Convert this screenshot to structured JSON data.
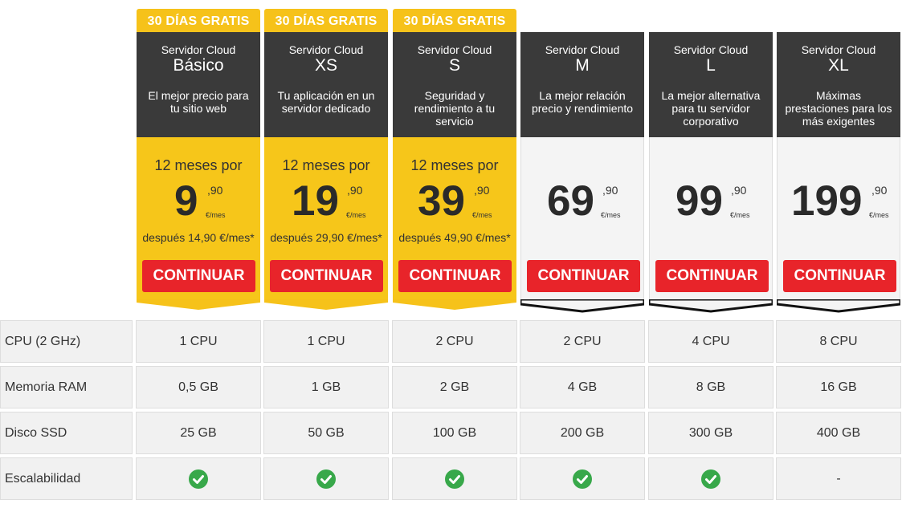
{
  "plans": [
    {
      "badge": "30 DÍAS GRATIS",
      "kind": "Servidor Cloud",
      "name": "Básico",
      "desc": "El mejor precio para tu sitio web",
      "pre": "12 meses por",
      "price_int": "9",
      "price_dec": ",90",
      "unit": "€/mes",
      "after": "después 14,90 €/mes*",
      "cta": "CONTINUAR",
      "cpu": "1 CPU",
      "ram": "0,5 GB",
      "ssd": "25 GB",
      "scal": true
    },
    {
      "badge": "30 DÍAS GRATIS",
      "kind": "Servidor Cloud",
      "name": "XS",
      "desc": "Tu aplicación en un servidor dedicado",
      "pre": "12 meses por",
      "price_int": "19",
      "price_dec": ",90",
      "unit": "€/mes",
      "after": "después 29,90 €/mes*",
      "cta": "CONTINUAR",
      "cpu": "1 CPU",
      "ram": "1 GB",
      "ssd": "50 GB",
      "scal": true
    },
    {
      "badge": "30 DÍAS GRATIS",
      "kind": "Servidor Cloud",
      "name": "S",
      "desc": "Seguridad y rendimiento a tu servicio",
      "pre": "12 meses por",
      "price_int": "39",
      "price_dec": ",90",
      "unit": "€/mes",
      "after": "después 49,90 €/mes*",
      "cta": "CONTINUAR",
      "cpu": "2 CPU",
      "ram": "2 GB",
      "ssd": "100 GB",
      "scal": true
    },
    {
      "badge": "",
      "kind": "Servidor Cloud",
      "name": "M",
      "desc": "La mejor relación precio y rendimiento",
      "pre": "",
      "price_int": "69",
      "price_dec": ",90",
      "unit": "€/mes",
      "after": "",
      "cta": "CONTINUAR",
      "cpu": "2 CPU",
      "ram": "4 GB",
      "ssd": "200 GB",
      "scal": true
    },
    {
      "badge": "",
      "kind": "Servidor Cloud",
      "name": "L",
      "desc": "La mejor alternativa para tu servidor corporativo",
      "pre": "",
      "price_int": "99",
      "price_dec": ",90",
      "unit": "€/mes",
      "after": "",
      "cta": "CONTINUAR",
      "cpu": "4 CPU",
      "ram": "8 GB",
      "ssd": "300 GB",
      "scal": true
    },
    {
      "badge": "",
      "kind": "Servidor Cloud",
      "name": "XL",
      "desc": "Máximas prestaciones para los más exigentes",
      "pre": "",
      "price_int": "199",
      "price_dec": ",90",
      "unit": "€/mes",
      "after": "",
      "cta": "CONTINUAR",
      "cpu": "8 CPU",
      "ram": "16 GB",
      "ssd": "400 GB",
      "scal": false,
      "scal_text": "-"
    }
  ],
  "features": {
    "cpu_label": "CPU (2 GHz)",
    "ram_label": "Memoria RAM",
    "ssd_label": "Disco SSD",
    "scal_label": "Escalabilidad"
  },
  "icons": {
    "included": "check-circle-icon"
  },
  "colors": {
    "promo": "#f6c21a",
    "header": "#3a3a3a",
    "cta": "#e8242a",
    "check": "#38a84a"
  }
}
